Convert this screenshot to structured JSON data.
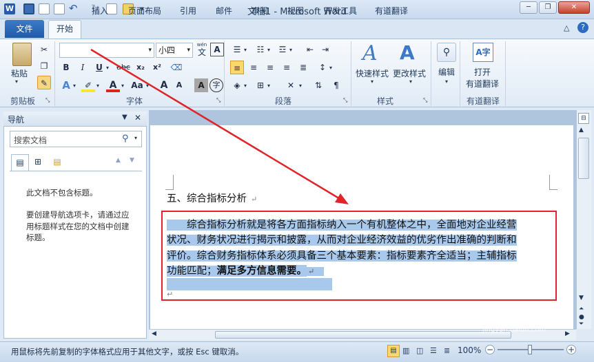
{
  "window": {
    "title": "文档1 - Microsoft Word",
    "minimize": "─",
    "restore": "❐",
    "close": "✕"
  },
  "quick_access": {
    "logo": "W"
  },
  "tabs": {
    "file": "文件",
    "items": [
      "开始",
      "插入",
      "页面布局",
      "引用",
      "邮件",
      "审阅",
      "视图",
      "开发工具",
      "有道翻译"
    ]
  },
  "ribbon": {
    "clipboard": {
      "paste": "粘贴",
      "label": "剪贴板"
    },
    "font": {
      "font_name": "",
      "font_size": "小四",
      "wen": "wén",
      "wen_char": "文",
      "a_char": "A",
      "label": "字体",
      "bold": "B",
      "italic": "I",
      "underline": "U",
      "strike": "abc",
      "sub": "x₂",
      "sup": "x²",
      "color_a": "A",
      "case": "Aa",
      "grow": "A",
      "shrink": "A",
      "clear": "A",
      "circle": "字"
    },
    "paragraph": {
      "label": "段落"
    },
    "styles": {
      "quick": "快速样式",
      "change": "更改样式",
      "label": "样式"
    },
    "editing": {
      "edit": "编辑"
    },
    "youdao": {
      "open": "打开",
      "translate": "有道翻译",
      "label": "有道翻译"
    }
  },
  "nav": {
    "title": "导航",
    "search_placeholder": "搜索文档",
    "no_headings": "此文档不包含标题。",
    "instructions": "要创建导航选项卡，请通过应用标题样式在您的文档中创建标题。"
  },
  "document": {
    "heading": "五、综合指标分析",
    "para_line1": "综合指标分析就是将各方面指标纳入一个有机整体之中，全面地对企业经营",
    "para_line2": "状况、财务状况进行揭示和披露，从而对企业经济效益的优劣作出准确的判断和",
    "para_line3": "评价。综合财务指标体系必须具备三个基本要素：指标要素齐全适当；主辅指标",
    "para_line4a": "功能匹配；",
    "para_line4b": "满足多方信息需要。",
    "para_mark": "↵"
  },
  "status": {
    "message": "用鼠标将先前复制的字体格式应用于其他文字，或按 Esc 键取消。",
    "zoom": "100%",
    "minus": "−",
    "plus": "+"
  },
  "watermark": {
    "brand": "Bai du 经验",
    "url": "jingyan.baidu.com"
  },
  "colors": {
    "accent": "#1f5aa8",
    "annotation": "#e0242a",
    "selection": "#a8c8ec"
  }
}
